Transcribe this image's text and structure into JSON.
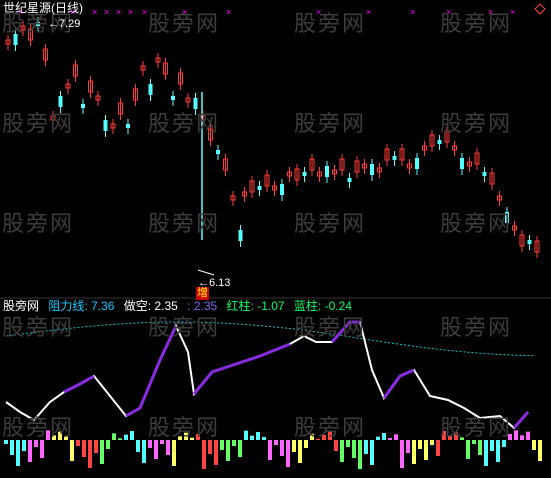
{
  "title": "世纪星源(日线)",
  "price_high_label": "7.29",
  "price_low_label": "6.13",
  "low_marker": "增",
  "watermark_text": "股旁网",
  "top_markers": [
    "×",
    "×",
    "×",
    "×",
    "×",
    "×",
    "×",
    "×",
    "×",
    "×",
    "×",
    "×",
    "×",
    "×",
    "×"
  ],
  "indicator": {
    "name": "股旁网",
    "items": [
      {
        "label": "阻力线:",
        "value": "7.36",
        "color": "#00ccff"
      },
      {
        "label": "做空:",
        "value": "2.35",
        "color": "#ffffff"
      },
      {
        "label": ":",
        "value": "2.35",
        "color": "#7b68ee"
      },
      {
        "label": "红柱:",
        "value": "-1.07",
        "color": "#00ff66"
      },
      {
        "label": "蓝柱:",
        "value": "-0.24",
        "color": "#00ff66"
      }
    ]
  },
  "colors": {
    "up": "#ff3c3c",
    "down": "#54ffff",
    "resistance": "#00cccc",
    "line_white": "#ffffff",
    "line_purple": "#8a2be2",
    "marker": "#ff00ff"
  }
}
